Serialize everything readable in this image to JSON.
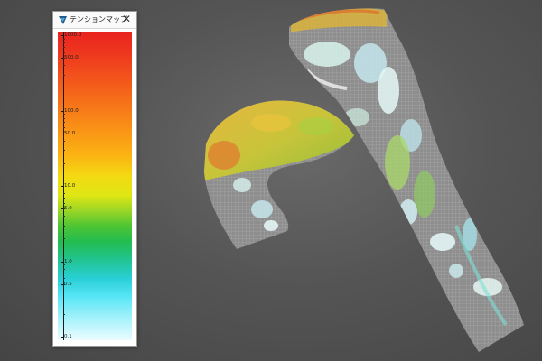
{
  "window": {
    "title": "テンションマップ",
    "close_glyph": "✕"
  },
  "legend": {
    "ticks": [
      {
        "label": "1000.0",
        "value": 1000.0
      },
      {
        "label": "500.0",
        "value": 500.0
      },
      {
        "label": "100.0",
        "value": 100.0
      },
      {
        "label": "50.0",
        "value": 50.0
      },
      {
        "label": "10.0",
        "value": 10.0
      },
      {
        "label": "5.0",
        "value": 5.0
      },
      {
        "label": "1.0",
        "value": 1.0
      },
      {
        "label": "0.5",
        "value": 0.5
      },
      {
        "label": "0.1",
        "value": 0.1
      }
    ],
    "scale": "log",
    "colors": {
      "high": "#e8231f",
      "mid_high": "#f98c17",
      "mid": "#f3da12",
      "mid_low": "#23bc50",
      "low": "#29cfd6",
      "lowest": "#ecfcff"
    }
  },
  "viewport": {
    "background": "#555555",
    "mesh_color": "#8c8c8c",
    "icons": {
      "app": "app-window-icon",
      "close": "close-icon"
    }
  }
}
